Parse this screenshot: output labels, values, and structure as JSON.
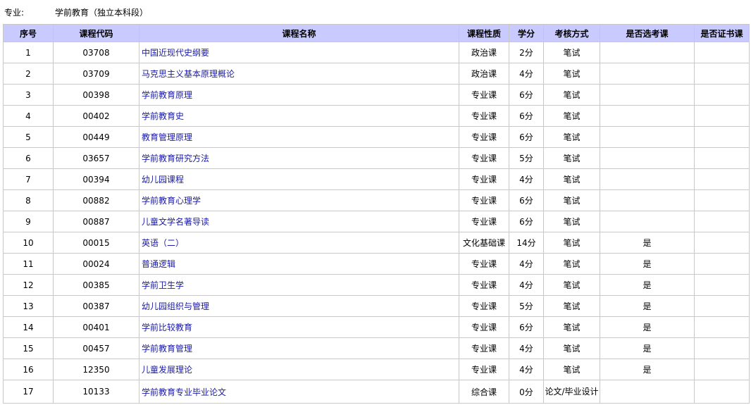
{
  "major": {
    "label": "专业:",
    "value": "学前教育（独立本科段）"
  },
  "colors": {
    "header_bg": "#c9caff",
    "link": "#1a1aa6",
    "border": "#c8c8c8"
  },
  "columns": [
    "序号",
    "课程代码",
    "课程名称",
    "课程性质",
    "学分",
    "考核方式",
    "是否选考课",
    "是否证书课"
  ],
  "rows": [
    {
      "no": "1",
      "code": "03708",
      "name": "中国近现代史纲要",
      "type": "政治课",
      "credit": "2分",
      "exam": "笔试",
      "elective": "",
      "cert": ""
    },
    {
      "no": "2",
      "code": "03709",
      "name": "马克思主义基本原理概论",
      "type": "政治课",
      "credit": "4分",
      "exam": "笔试",
      "elective": "",
      "cert": ""
    },
    {
      "no": "3",
      "code": "00398",
      "name": "学前教育原理",
      "type": "专业课",
      "credit": "6分",
      "exam": "笔试",
      "elective": "",
      "cert": ""
    },
    {
      "no": "4",
      "code": "00402",
      "name": "学前教育史",
      "type": "专业课",
      "credit": "6分",
      "exam": "笔试",
      "elective": "",
      "cert": ""
    },
    {
      "no": "5",
      "code": "00449",
      "name": "教育管理原理",
      "type": "专业课",
      "credit": "6分",
      "exam": "笔试",
      "elective": "",
      "cert": ""
    },
    {
      "no": "6",
      "code": "03657",
      "name": "学前教育研究方法",
      "type": "专业课",
      "credit": "5分",
      "exam": "笔试",
      "elective": "",
      "cert": ""
    },
    {
      "no": "7",
      "code": "00394",
      "name": "幼儿园课程",
      "type": "专业课",
      "credit": "4分",
      "exam": "笔试",
      "elective": "",
      "cert": ""
    },
    {
      "no": "8",
      "code": "00882",
      "name": "学前教育心理学",
      "type": "专业课",
      "credit": "6分",
      "exam": "笔试",
      "elective": "",
      "cert": ""
    },
    {
      "no": "9",
      "code": "00887",
      "name": "儿童文学名著导读",
      "type": "专业课",
      "credit": "6分",
      "exam": "笔试",
      "elective": "",
      "cert": ""
    },
    {
      "no": "10",
      "code": "00015",
      "name": "英语（二）",
      "type": "文化基础课",
      "credit": "14分",
      "exam": "笔试",
      "elective": "是",
      "cert": ""
    },
    {
      "no": "11",
      "code": "00024",
      "name": "普通逻辑",
      "type": "专业课",
      "credit": "4分",
      "exam": "笔试",
      "elective": "是",
      "cert": ""
    },
    {
      "no": "12",
      "code": "00385",
      "name": "学前卫生学",
      "type": "专业课",
      "credit": "4分",
      "exam": "笔试",
      "elective": "是",
      "cert": ""
    },
    {
      "no": "13",
      "code": "00387",
      "name": "幼儿园组织与管理",
      "type": "专业课",
      "credit": "5分",
      "exam": "笔试",
      "elective": "是",
      "cert": ""
    },
    {
      "no": "14",
      "code": "00401",
      "name": "学前比较教育",
      "type": "专业课",
      "credit": "6分",
      "exam": "笔试",
      "elective": "是",
      "cert": ""
    },
    {
      "no": "15",
      "code": "00457",
      "name": "学前教育管理",
      "type": "专业课",
      "credit": "4分",
      "exam": "笔试",
      "elective": "是",
      "cert": ""
    },
    {
      "no": "16",
      "code": "12350",
      "name": "儿童发展理论",
      "type": "专业课",
      "credit": "4分",
      "exam": "笔试",
      "elective": "是",
      "cert": ""
    },
    {
      "no": "17",
      "code": "10133",
      "name": "学前教育专业毕业论文",
      "type": "综合课",
      "credit": "0分",
      "exam": "论文/毕业设计",
      "elective": "",
      "cert": ""
    }
  ]
}
